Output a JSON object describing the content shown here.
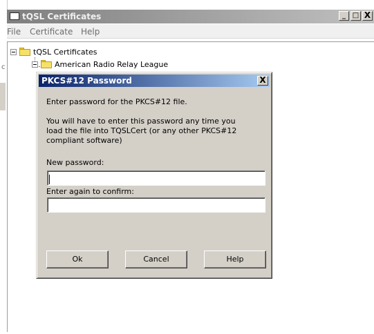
{
  "window": {
    "title": "tQSL Certificates",
    "controls": {
      "minimize": "_",
      "maximize": "□",
      "close": "X"
    }
  },
  "menu": {
    "items": [
      "File",
      "Certificate",
      "Help"
    ]
  },
  "tree": {
    "root": "tQSL Certificates",
    "child": "American Radio Relay League"
  },
  "dialog": {
    "title": "PKCS#12 Password",
    "close": "X",
    "intro": "Enter password for the PKCS#12 file.",
    "note_line1": "You will have to enter this password any time you",
    "note_line2": "load the file into TQSLCert (or any other PKCS#12",
    "note_line3": "compliant software)",
    "new_password_label": "New password:",
    "new_password_value": "",
    "confirm_label": "Enter again to confirm:",
    "confirm_value": "",
    "buttons": {
      "ok": "Ok",
      "cancel": "Cancel",
      "help": "Help"
    }
  },
  "colors": {
    "dialog_title_start": "#0a246a",
    "dialog_title_end": "#a6caf0",
    "window_title_inactive": "#7f7f7f",
    "face": "#d4d0c8"
  }
}
